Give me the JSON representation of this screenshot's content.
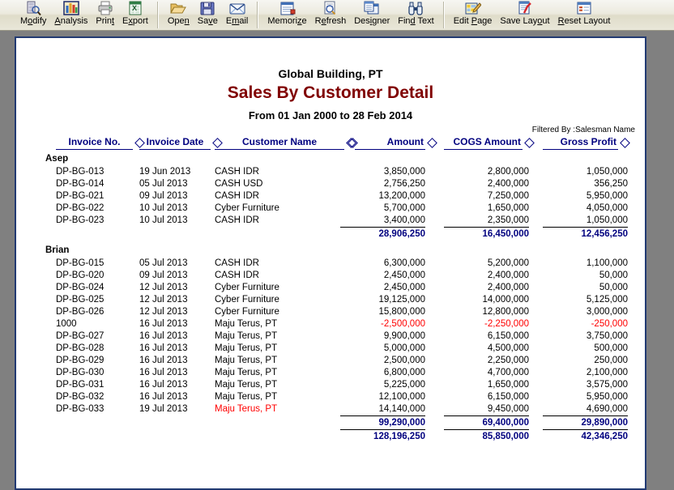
{
  "toolbar": {
    "groups": [
      {
        "buttons": [
          {
            "label": "Modify",
            "accel": "o",
            "icon": "modify-icon"
          },
          {
            "label": "Analysis",
            "accel": "A",
            "icon": "analysis-icon"
          },
          {
            "label": "Print",
            "accel": "t",
            "icon": "print-icon"
          },
          {
            "label": "Export",
            "accel": "x",
            "icon": "export-icon"
          }
        ]
      },
      {
        "buttons": [
          {
            "label": "Open",
            "accel": "n",
            "icon": "open-folder-icon"
          },
          {
            "label": "Save",
            "accel": "v",
            "icon": "save-disk-icon"
          },
          {
            "label": "Email",
            "accel": "m",
            "icon": "email-envelope-icon"
          }
        ]
      },
      {
        "buttons": [
          {
            "label": "Memorize",
            "accel": "z",
            "icon": "memorize-notebook-icon"
          },
          {
            "label": "Refresh",
            "accel": "e",
            "icon": "refresh-icon"
          },
          {
            "label": "Designer",
            "accel": "i",
            "icon": "designer-icon"
          },
          {
            "label": "Find Text",
            "accel": "d",
            "icon": "find-text-binoculars-icon"
          }
        ]
      },
      {
        "buttons": [
          {
            "label": "Edit Page",
            "accel": "P",
            "icon": "edit-page-icon"
          },
          {
            "label": "Save Layout",
            "accel": "o",
            "icon": "save-layout-icon"
          },
          {
            "label": "Reset Layout",
            "accel": "R",
            "icon": "reset-layout-icon"
          }
        ]
      }
    ]
  },
  "report": {
    "company": "Global Building, PT",
    "title": "Sales By Customer Detail",
    "period": "From 01 Jan 2000 to 28 Feb 2014",
    "filter": "Filtered By :Salesman Name",
    "columns": [
      {
        "label": "Invoice No.",
        "align": "center"
      },
      {
        "label": "Invoice Date",
        "align": "center"
      },
      {
        "label": "Customer Name",
        "align": "center"
      },
      {
        "label": "Amount",
        "align": "right"
      },
      {
        "label": "COGS Amount",
        "align": "right"
      },
      {
        "label": "Gross Profit",
        "align": "right"
      }
    ],
    "groups": [
      {
        "name": "Asep",
        "rows": [
          {
            "invoice": "DP-BG-013",
            "date": "19 Jun 2013",
            "customer": "CASH IDR",
            "amount": "3,850,000",
            "cogs": "2,800,000",
            "gross": "1,050,000"
          },
          {
            "invoice": "DP-BG-014",
            "date": "05 Jul 2013",
            "customer": "CASH USD",
            "amount": "2,756,250",
            "cogs": "2,400,000",
            "gross": "356,250"
          },
          {
            "invoice": "DP-BG-021",
            "date": "09 Jul 2013",
            "customer": "CASH IDR",
            "amount": "13,200,000",
            "cogs": "7,250,000",
            "gross": "5,950,000"
          },
          {
            "invoice": "DP-BG-022",
            "date": "10 Jul 2013",
            "customer": "Cyber Furniture",
            "amount": "5,700,000",
            "cogs": "1,650,000",
            "gross": "4,050,000"
          },
          {
            "invoice": "DP-BG-023",
            "date": "10 Jul 2013",
            "customer": "CASH IDR",
            "amount": "3,400,000",
            "cogs": "2,350,000",
            "gross": "1,050,000"
          }
        ],
        "subtotal": {
          "amount": "28,906,250",
          "cogs": "16,450,000",
          "gross": "12,456,250"
        }
      },
      {
        "name": "Brian",
        "rows": [
          {
            "invoice": "DP-BG-015",
            "date": "05 Jul 2013",
            "customer": "CASH IDR",
            "amount": "6,300,000",
            "cogs": "5,200,000",
            "gross": "1,100,000"
          },
          {
            "invoice": "DP-BG-020",
            "date": "09 Jul 2013",
            "customer": "CASH IDR",
            "amount": "2,450,000",
            "cogs": "2,400,000",
            "gross": "50,000"
          },
          {
            "invoice": "DP-BG-024",
            "date": "12 Jul 2013",
            "customer": "Cyber Furniture",
            "amount": "2,450,000",
            "cogs": "2,400,000",
            "gross": "50,000"
          },
          {
            "invoice": "DP-BG-025",
            "date": "12 Jul 2013",
            "customer": "Cyber Furniture",
            "amount": "19,125,000",
            "cogs": "14,000,000",
            "gross": "5,125,000"
          },
          {
            "invoice": "DP-BG-026",
            "date": "12 Jul 2013",
            "customer": "Cyber Furniture",
            "amount": "15,800,000",
            "cogs": "12,800,000",
            "gross": "3,000,000"
          },
          {
            "invoice": "1000",
            "date": "16 Jul 2013",
            "customer": "Maju Terus, PT",
            "amount": "-2,500,000",
            "cogs": "-2,250,000",
            "gross": "-250,000",
            "negative": true
          },
          {
            "invoice": "DP-BG-027",
            "date": "16 Jul 2013",
            "customer": "Maju Terus, PT",
            "amount": "9,900,000",
            "cogs": "6,150,000",
            "gross": "3,750,000"
          },
          {
            "invoice": "DP-BG-028",
            "date": "16 Jul 2013",
            "customer": "Maju Terus, PT",
            "amount": "5,000,000",
            "cogs": "4,500,000",
            "gross": "500,000"
          },
          {
            "invoice": "DP-BG-029",
            "date": "16 Jul 2013",
            "customer": "Maju Terus, PT",
            "amount": "2,500,000",
            "cogs": "2,250,000",
            "gross": "250,000"
          },
          {
            "invoice": "DP-BG-030",
            "date": "16 Jul 2013",
            "customer": "Maju Terus, PT",
            "amount": "6,800,000",
            "cogs": "4,700,000",
            "gross": "2,100,000"
          },
          {
            "invoice": "DP-BG-031",
            "date": "16 Jul 2013",
            "customer": "Maju Terus, PT",
            "amount": "5,225,000",
            "cogs": "1,650,000",
            "gross": "3,575,000"
          },
          {
            "invoice": "DP-BG-032",
            "date": "16 Jul 2013",
            "customer": "Maju Terus, PT",
            "amount": "12,100,000",
            "cogs": "6,150,000",
            "gross": "5,950,000"
          },
          {
            "invoice": "DP-BG-033",
            "date": "19 Jul 2013",
            "customer": "Maju Terus, PT",
            "amount": "14,140,000",
            "cogs": "9,450,000",
            "gross": "4,690,000",
            "customer_red": true
          }
        ],
        "subtotal": {
          "amount": "99,290,000",
          "cogs": "69,400,000",
          "gross": "29,890,000"
        }
      }
    ],
    "grand_total": {
      "amount": "128,196,250",
      "cogs": "85,850,000",
      "gross": "42,346,250"
    }
  },
  "colors": {
    "title": "#800000",
    "header_blue": "#00007f",
    "total_blue": "#00007f",
    "negative_red": "#ff0000",
    "page_border": "#223a72",
    "desktop": "#808080"
  }
}
